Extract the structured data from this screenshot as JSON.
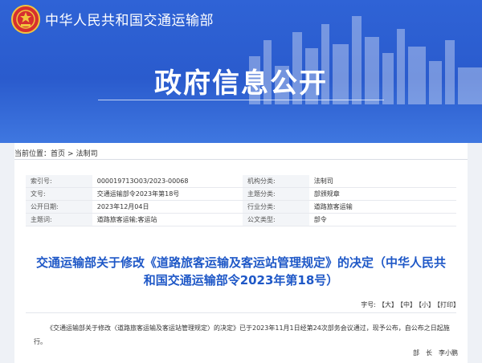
{
  "header": {
    "site_title": "中华人民共和国交通运输部",
    "big_title": "政府信息公开"
  },
  "breadcrumb": {
    "label": "当前位置：",
    "items": [
      "首页",
      "法制司"
    ],
    "separator": ">"
  },
  "info": {
    "rows": [
      {
        "l1": "索引号:",
        "v1": "000019713O03/2023-00068",
        "l2": "机构分类:",
        "v2": "法制司"
      },
      {
        "l1": "文号:",
        "v1": "交通运输部令2023年第18号",
        "l2": "主题分类:",
        "v2": "部颁规章"
      },
      {
        "l1": "公开日期:",
        "v1": "2023年12月04日",
        "l2": "行业分类:",
        "v2": "道路旅客运输"
      },
      {
        "l1": "主题词:",
        "v1": "道路旅客运输;客运站",
        "l2": "公文类型:",
        "v2": "部令"
      }
    ]
  },
  "document": {
    "title": "交通运输部关于修改《道路旅客运输及客运站管理规定》的决定（中华人民共和国交通运输部令2023年第18号）",
    "body": "《交通运输部关于修改〈道路旅客运输及客运站管理规定〉的决定》已于2023年11月1日经第24次部务会议通过，现予公布，自公布之日起施行。",
    "signer_title": "部　长",
    "signer_name": "李小鹏"
  },
  "font_size": {
    "label": "字号:",
    "large": "【大】",
    "medium": "【中】",
    "small": "【小】",
    "print": "【打印】"
  },
  "colors": {
    "banner": "#2f63d6",
    "title_blue": "#1f58c7"
  }
}
